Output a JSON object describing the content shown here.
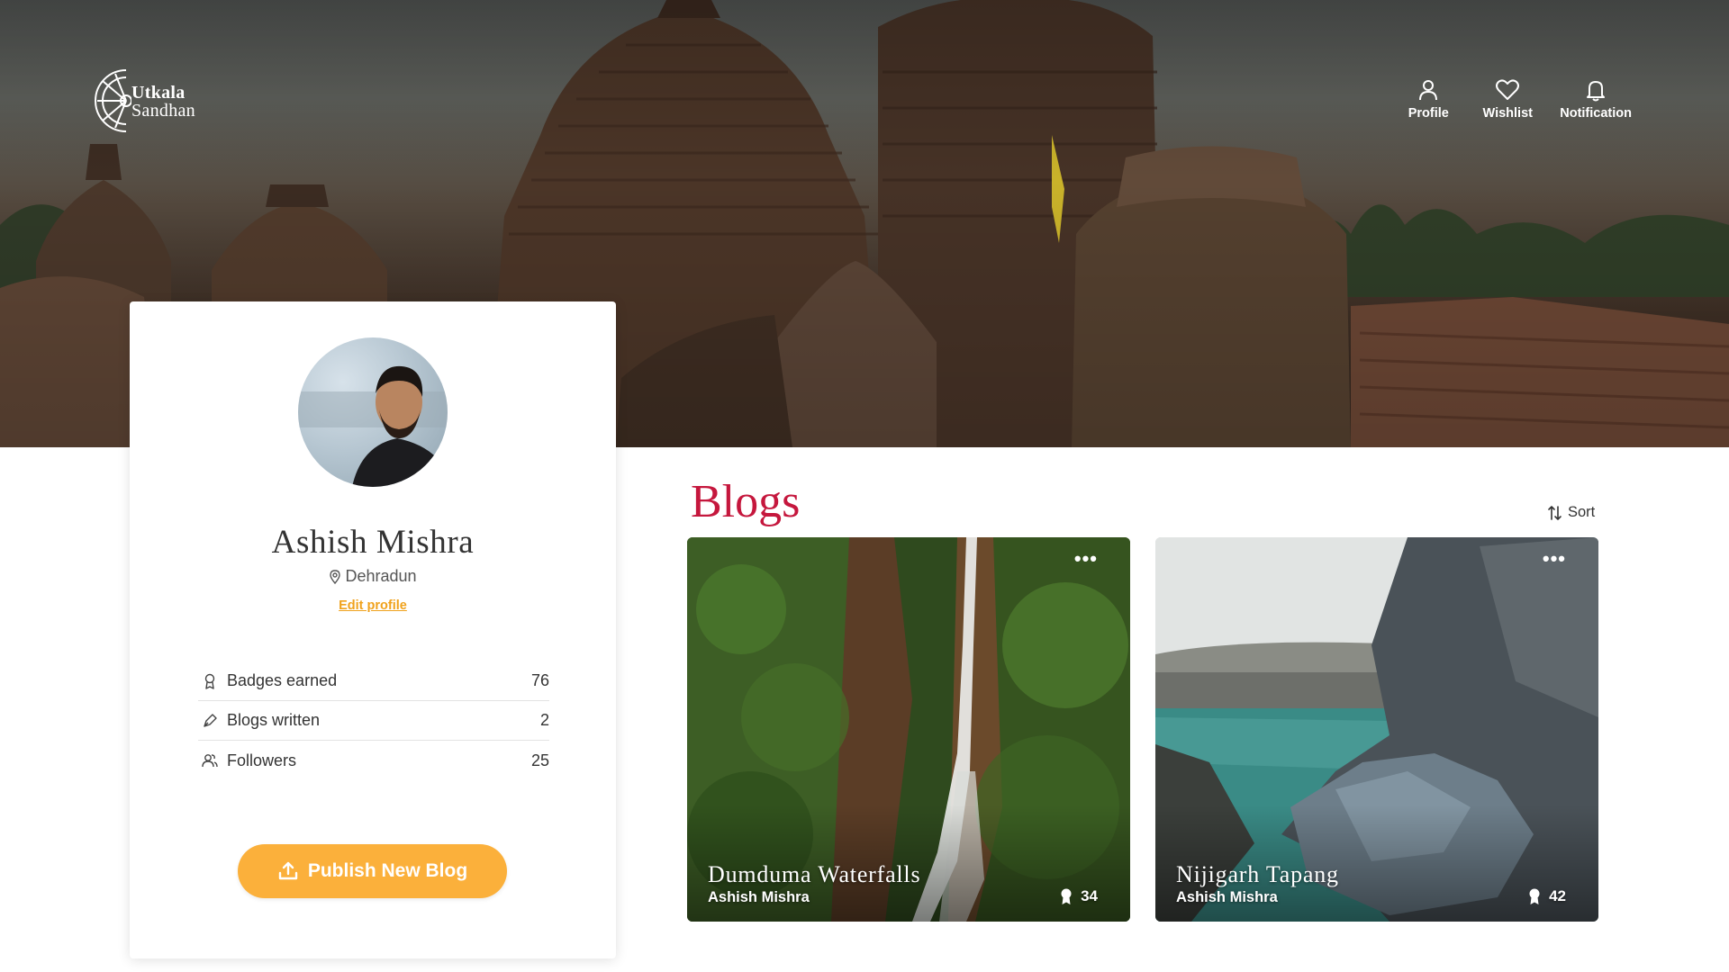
{
  "brand": {
    "line1": "Utkala",
    "line2": "Sandhan"
  },
  "nav": {
    "profile": "Profile",
    "wishlist": "Wishlist",
    "notification": "Notification"
  },
  "profile": {
    "name": "Ashish Mishra",
    "location": "Dehradun",
    "edit_label": "Edit profile",
    "stats": [
      {
        "icon": "badge-icon",
        "label": "Badges earned",
        "value": "76"
      },
      {
        "icon": "pen-icon",
        "label": "Blogs written",
        "value": "2"
      },
      {
        "icon": "followers-icon",
        "label": "Followers",
        "value": "25"
      }
    ],
    "publish_label": "Publish New Blog"
  },
  "blogs": {
    "heading": "Blogs",
    "sort_label": "Sort",
    "more_label": "•••",
    "items": [
      {
        "title": "Dumduma Waterfalls",
        "author": "Ashish Mishra",
        "badges": "34"
      },
      {
        "title": "Nijigarh Tapang",
        "author": "Ashish Mishra",
        "badges": "42"
      }
    ]
  },
  "colors": {
    "accent": "#fbb03b",
    "edit_link": "#f0a21c",
    "blogs_heading": "#c5173d"
  }
}
